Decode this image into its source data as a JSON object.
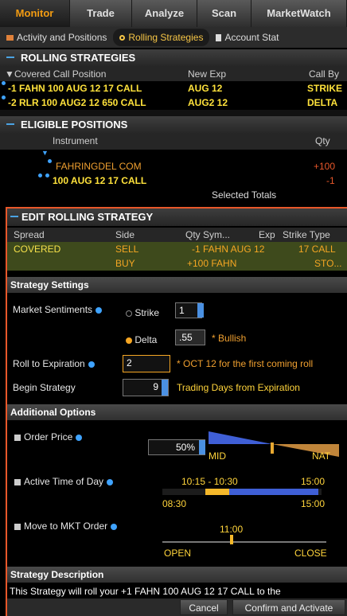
{
  "top_tabs": [
    "Monitor",
    "Trade",
    "Analyze",
    "Scan",
    "MarketWatch"
  ],
  "sub_tabs": [
    "Activity and Positions",
    "Rolling Strategies",
    "Account Stat"
  ],
  "rolling": {
    "title": "ROLLING STRATEGIES",
    "columns": [
      "Covered Call Position",
      "New Exp",
      "Call By"
    ],
    "rows": [
      {
        "position": "-1 FAHN 100 AUG 12 17 CALL",
        "new_exp": "AUG 12",
        "call_by": "STRIKE"
      },
      {
        "position": "-2 RLR 100 AUG2 12 650 CALL",
        "new_exp": "AUG2 12",
        "call_by": "DELTA"
      }
    ]
  },
  "eligible": {
    "title": "ELIGIBLE POSITIONS",
    "columns": [
      "Instrument",
      "Qty"
    ],
    "rows": [
      {
        "instrument": "FAHRINGDEL COM",
        "qty": "+100"
      },
      {
        "instrument": "100 AUG 12 17 CALL",
        "qty": "-1"
      }
    ],
    "totals_label": "Selected Totals"
  },
  "edit": {
    "title": "EDIT ROLLING STRATEGY",
    "columns": [
      "Spread",
      "Side",
      "Qty Sym...",
      "Exp",
      "Strike Type"
    ],
    "rows": [
      {
        "spread": "COVERED",
        "side": "SELL",
        "qty_sym": "-1 FAHN AUG 12",
        "exp": "",
        "strike_type": "17 CALL"
      },
      {
        "spread": "",
        "side": "BUY",
        "qty_sym": "+100 FAHN",
        "exp": "",
        "strike_type": "STO..."
      }
    ]
  },
  "settings": {
    "title": "Strategy Settings",
    "market_sentiments_label": "Market Sentiments",
    "strike_label": "Strike",
    "strike_value": "1",
    "delta_label": "Delta",
    "delta_value": ".55",
    "bullish_label": "* Bullish",
    "roll_label": "Roll to Expiration",
    "roll_value": "2",
    "roll_note": "* OCT 12 for the first coming roll",
    "begin_label": "Begin Strategy",
    "begin_value": "9",
    "begin_note": "Trading Days from Expiration"
  },
  "additional": {
    "title": "Additional Options",
    "order_price_label": "Order Price",
    "order_price_value": "50%",
    "mid_label": "MID",
    "nat_label": "NAT",
    "active_time_label": "Active Time of Day",
    "active_range": "10:15 - 10:30",
    "time_end_top": "15:00",
    "time_start": "08:30",
    "time_end": "15:00",
    "mkt_label": "Move to MKT Order",
    "mkt_time": "11:00",
    "open_label": "OPEN",
    "close_label": "CLOSE"
  },
  "description": {
    "title": "Strategy Description",
    "text": "This Strategy will roll your +1 FAHN 100 AUG 12 17 CALL to the"
  },
  "buttons": {
    "cancel": "Cancel",
    "confirm": "Confirm and Activate"
  }
}
